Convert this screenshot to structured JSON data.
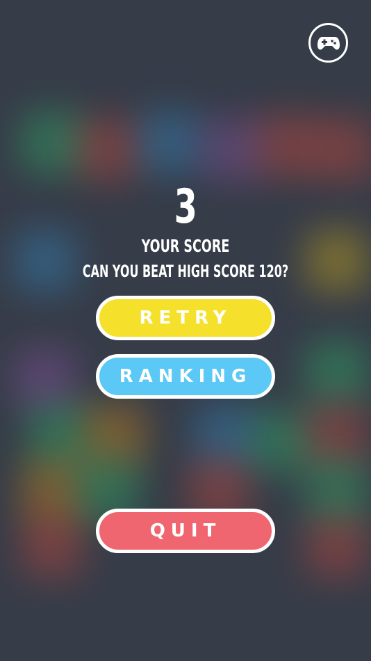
{
  "score": {
    "value": "3",
    "label": "YOUR SCORE",
    "high_score_text": "CAN YOU BEAT HIGH SCORE 120?"
  },
  "buttons": {
    "retry": "RETRY",
    "ranking": "RANKING",
    "quit": "QUIT"
  },
  "icons": {
    "top_right": "gamepad-icon"
  },
  "colors": {
    "background": "#363c48",
    "retry": "#f5e12b",
    "ranking": "#5bc8f5",
    "quit": "#f06670",
    "border": "#ffffff"
  }
}
